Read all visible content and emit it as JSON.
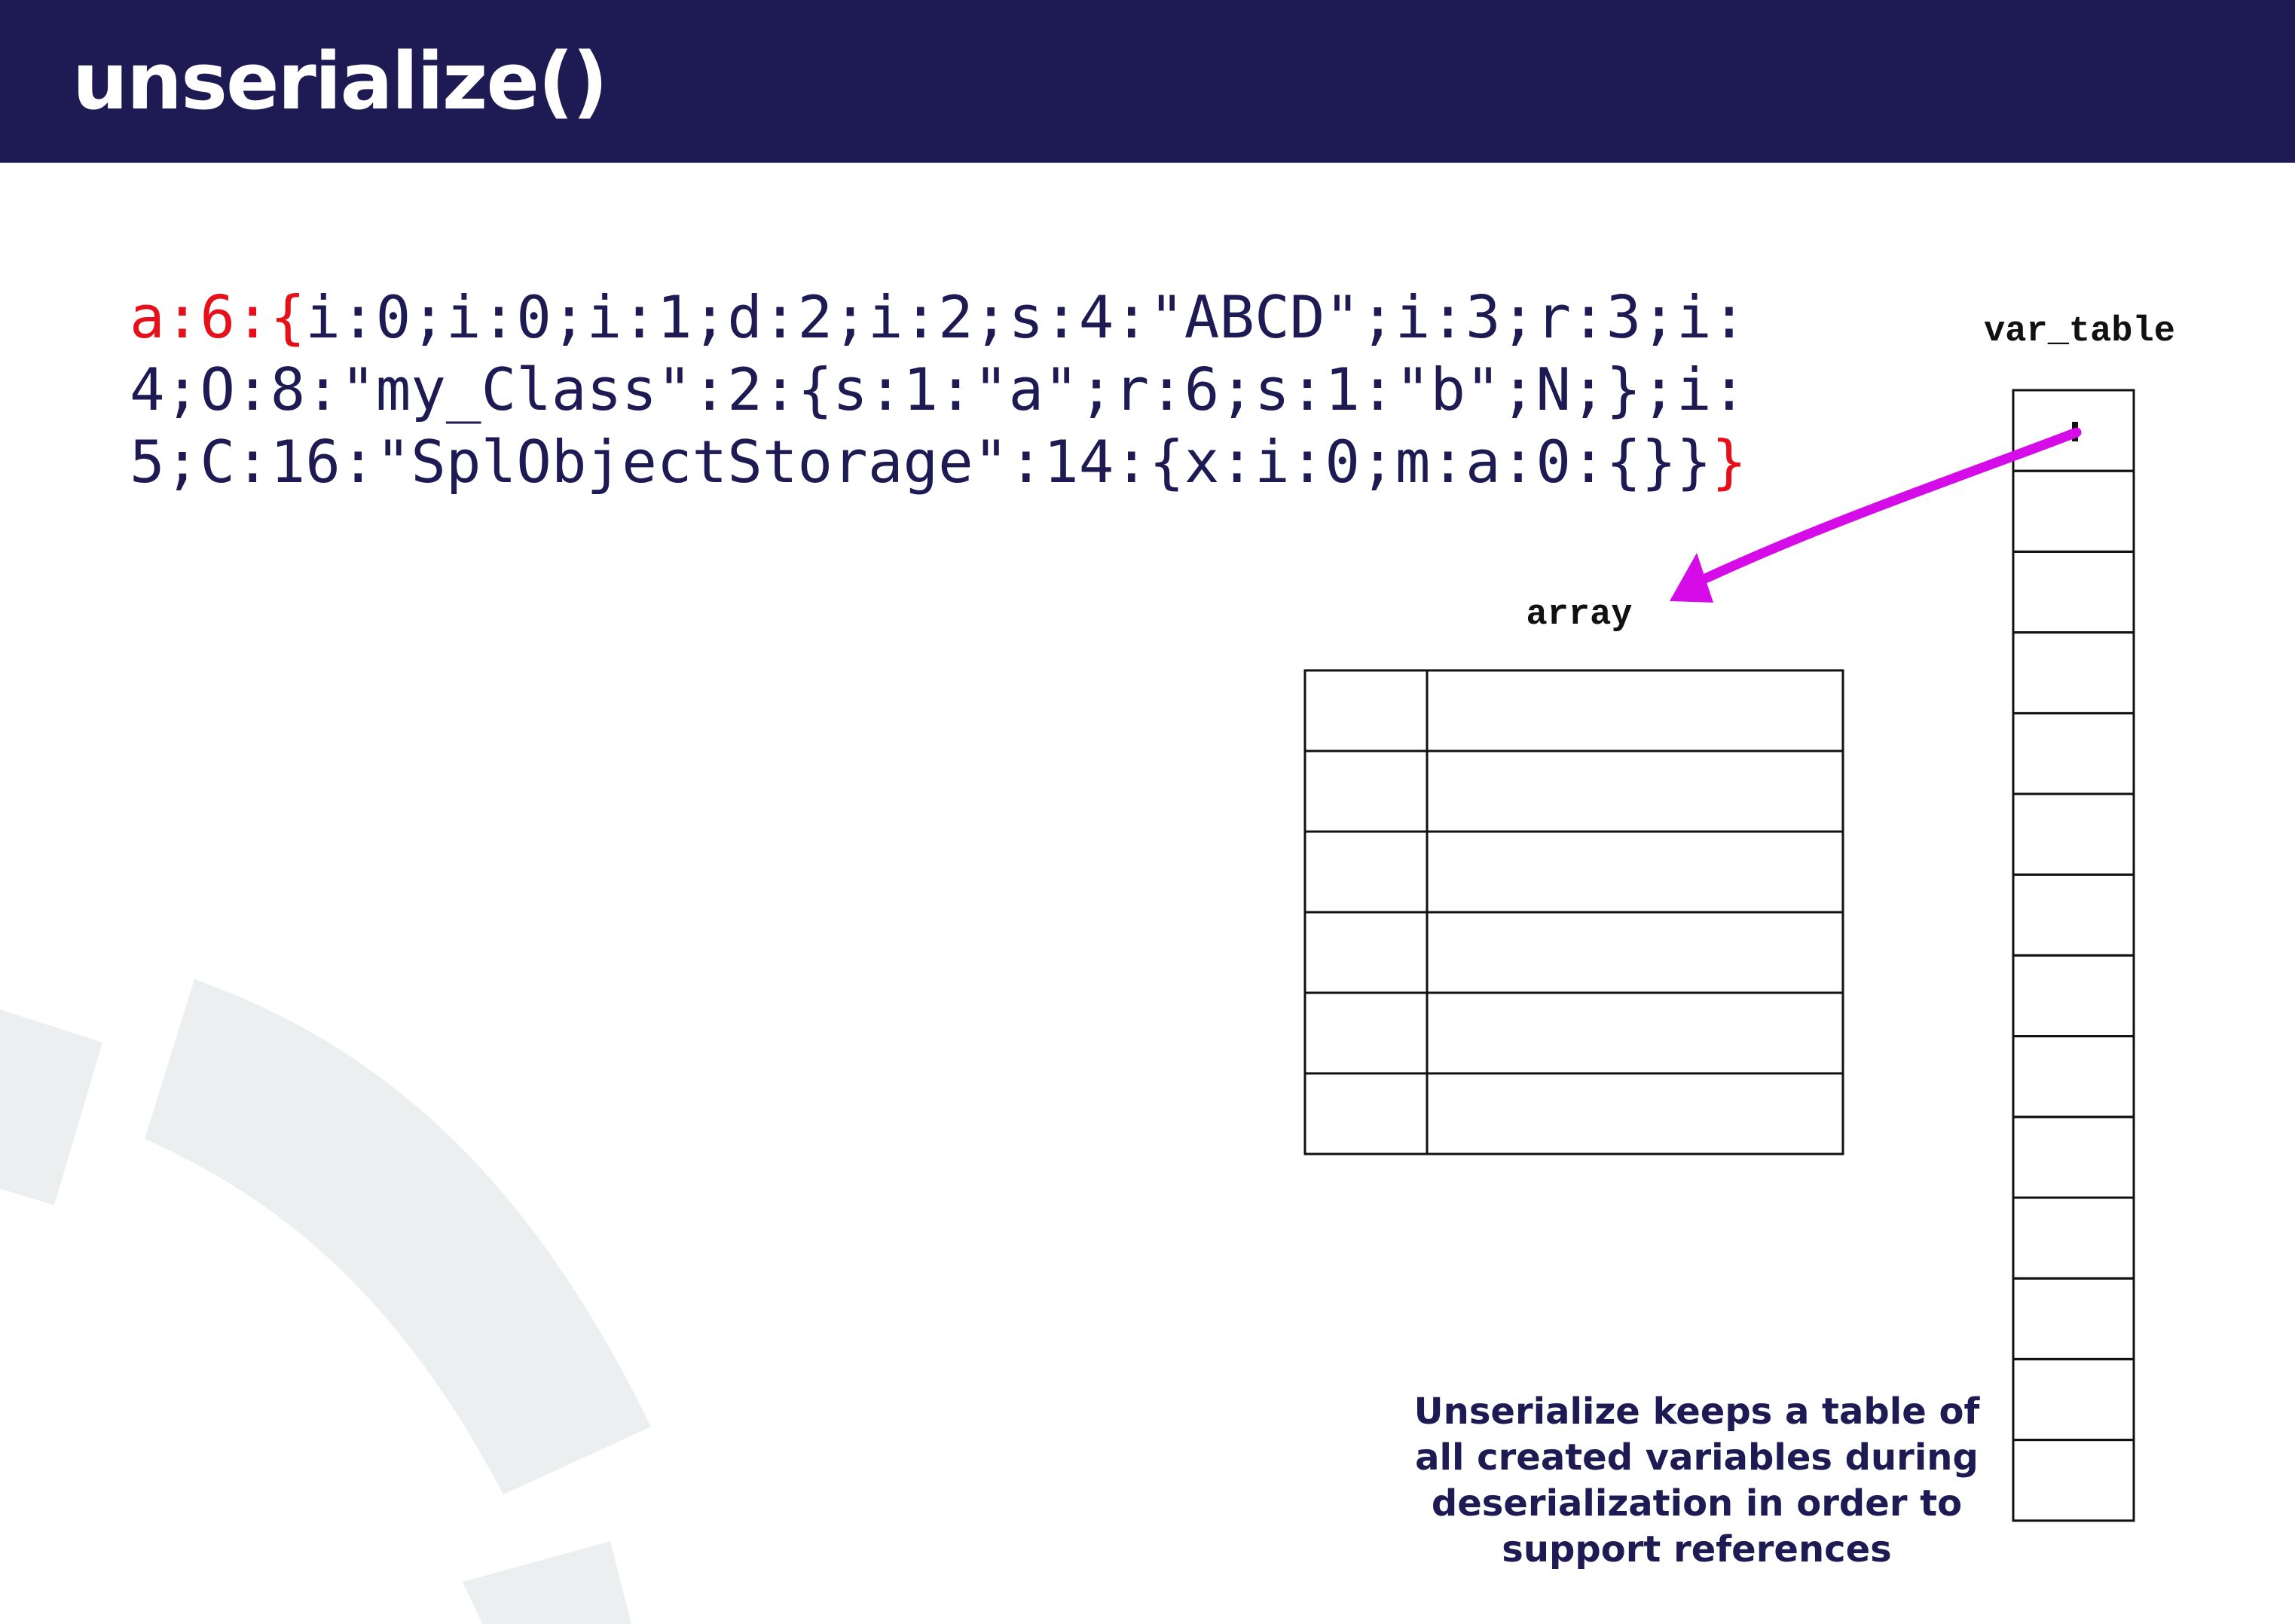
{
  "slide": {
    "title": "unserialize()",
    "caption": "Unserialize keeps a table of all created variables during deserialization in order to support references"
  },
  "code": {
    "lines": [
      {
        "highlight_prefix": "a:6:{",
        "text": "i:0;i:0;i:1;d:2;i:2;s:4:\"ABCD\";i:3;r:3;i:",
        "highlight_suffix": ""
      },
      {
        "highlight_prefix": "",
        "text": "4;O:8:\"my_Class\":2:{s:1:\"a\";r:6;s:1:\"b\";N;};i:",
        "highlight_suffix": ""
      },
      {
        "highlight_prefix": "",
        "text": "5;C:16:\"SplObjectStorage\":14:{x:i:0;m:a:0:{}}",
        "highlight_suffix": "}"
      }
    ]
  },
  "diagram": {
    "array_label": "array",
    "var_table_label": "var_table",
    "array_rows": 6,
    "var_table_rows": 14,
    "pointer_color": "#d60ce8",
    "colors": {
      "title_bar": "#1e1b54",
      "text": "#1e1b54",
      "highlight": "#e5101a",
      "background_arc": "#eceff0"
    }
  }
}
